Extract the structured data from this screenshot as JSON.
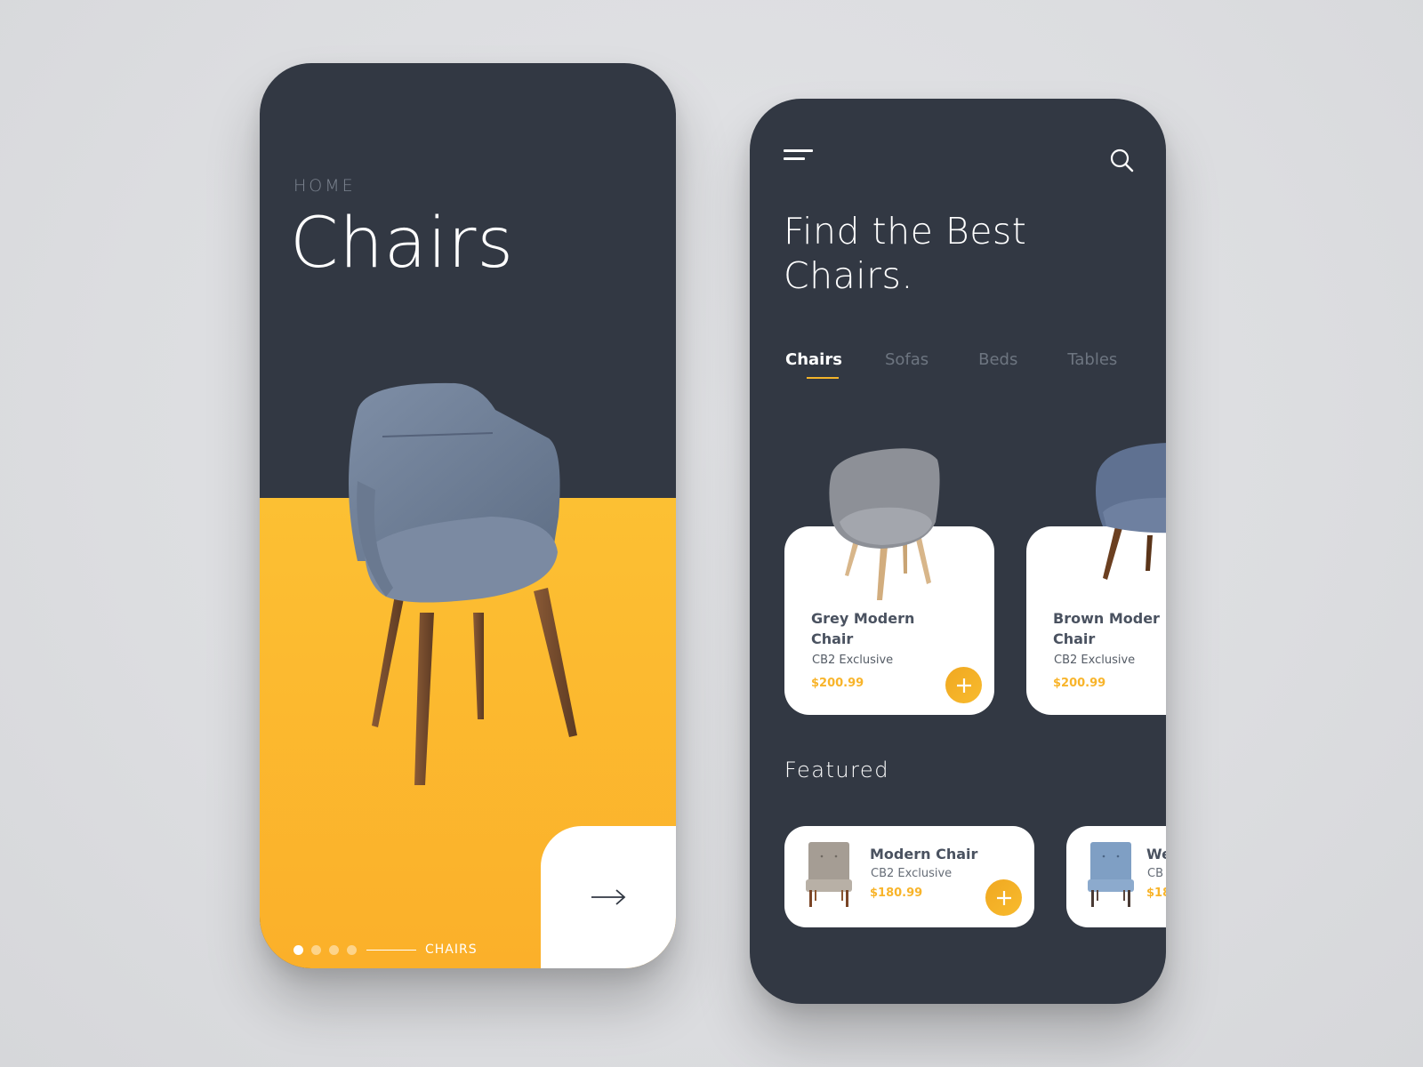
{
  "colors": {
    "background": "#dcdde0",
    "dark": "#323843",
    "accent": "#f8b42a",
    "yellow": "#fcc033",
    "white": "#ffffff"
  },
  "screen1": {
    "breadcrumb": "HOME",
    "title": "Chairs",
    "pagination": {
      "total": 4,
      "active_index": 0,
      "label": "CHAIRS"
    },
    "next_icon": "arrow-right-icon"
  },
  "screen2": {
    "menu_icon": "hamburger-menu-icon",
    "search_icon": "search-icon",
    "heading_line1": "Find the Best",
    "heading_line2": "Chairs.",
    "tabs": [
      {
        "label": "Chairs",
        "active": true
      },
      {
        "label": "Sofas",
        "active": false
      },
      {
        "label": "Beds",
        "active": false
      },
      {
        "label": "Tables",
        "active": false
      }
    ],
    "products": [
      {
        "name_line1": "Grey Modern",
        "name_line2": "Chair",
        "brand": "CB2 Exclusive",
        "price": "$200.99"
      },
      {
        "name_line1": "Brown Moder",
        "name_line2": "Chair",
        "brand": "CB2 Exclusive",
        "price": "$200.99"
      }
    ],
    "featured_title": "Featured",
    "featured": [
      {
        "name": "Modern Chair",
        "brand": "CB2 Exclusive",
        "price": "$180.99"
      },
      {
        "name": "We",
        "brand": "CB",
        "price": "$18"
      }
    ],
    "add_icon": "plus-icon"
  }
}
